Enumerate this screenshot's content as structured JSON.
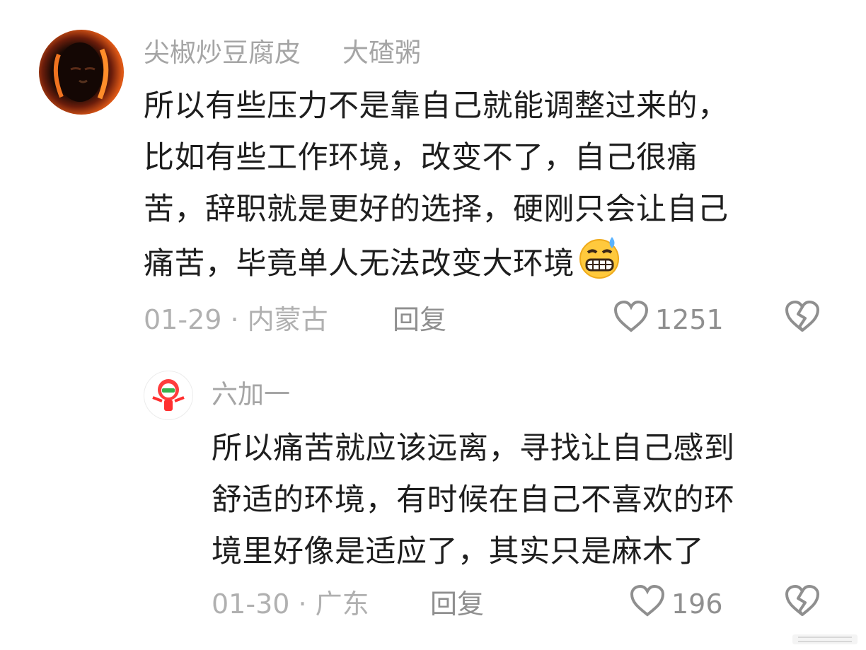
{
  "comments": [
    {
      "username": "尖椒炒豆腐皮",
      "tag": "大碴粥",
      "text": "所以有些压力不是靠自己就能调整过来的，\n比如有些工作环境，改变不了，自己很痛\n苦，辞职就是更好的选择，硬刚只会让自己\n痛苦，毕竟单人无法改变大环境",
      "meta": "01-29 · 内蒙古",
      "reply_label": "回复",
      "like_count": "1251",
      "emoji": "grimacing-sweat-emoji"
    },
    {
      "username": "六加一",
      "text": "所以痛苦就应该远离，寻找让自己感到\n舒适的环境，有时候在自己不喜欢的环\n境里好像是适应了，其实只是麻木了",
      "meta": "01-30 · 广东",
      "reply_label": "回复",
      "like_count": "196"
    }
  ],
  "icons": {
    "like": "heart-outline-icon",
    "dislike": "broken-heart-icon"
  },
  "colors": {
    "text": "#1e1e1e",
    "muted": "#a5a5a5",
    "icon": "#8f8f8f"
  }
}
